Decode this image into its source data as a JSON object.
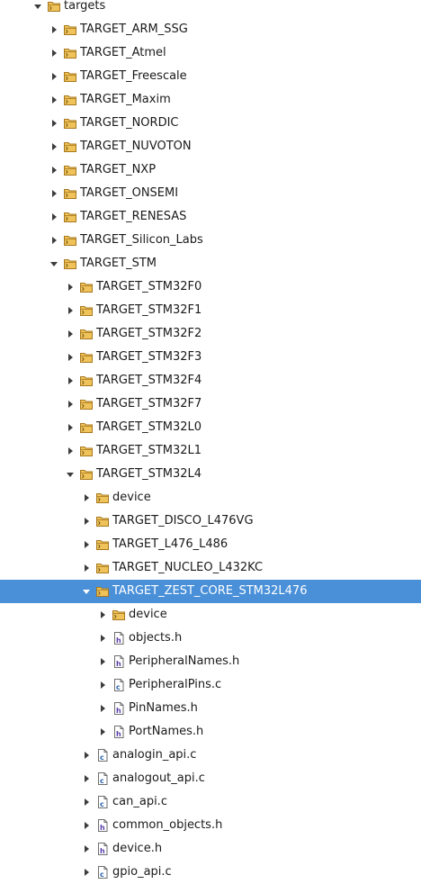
{
  "tree": {
    "items": [
      {
        "label": "targets",
        "type": "folder",
        "depth": 0,
        "expanded": true
      },
      {
        "label": "TARGET_ARM_SSG",
        "type": "folder",
        "depth": 1,
        "expanded": false
      },
      {
        "label": "TARGET_Atmel",
        "type": "folder",
        "depth": 1,
        "expanded": false
      },
      {
        "label": "TARGET_Freescale",
        "type": "folder",
        "depth": 1,
        "expanded": false
      },
      {
        "label": "TARGET_Maxim",
        "type": "folder",
        "depth": 1,
        "expanded": false
      },
      {
        "label": "TARGET_NORDIC",
        "type": "folder",
        "depth": 1,
        "expanded": false
      },
      {
        "label": "TARGET_NUVOTON",
        "type": "folder",
        "depth": 1,
        "expanded": false
      },
      {
        "label": "TARGET_NXP",
        "type": "folder",
        "depth": 1,
        "expanded": false
      },
      {
        "label": "TARGET_ONSEMI",
        "type": "folder",
        "depth": 1,
        "expanded": false
      },
      {
        "label": "TARGET_RENESAS",
        "type": "folder",
        "depth": 1,
        "expanded": false
      },
      {
        "label": "TARGET_Silicon_Labs",
        "type": "folder",
        "depth": 1,
        "expanded": false
      },
      {
        "label": "TARGET_STM",
        "type": "folder",
        "depth": 1,
        "expanded": true
      },
      {
        "label": "TARGET_STM32F0",
        "type": "folder",
        "depth": 2,
        "expanded": false
      },
      {
        "label": "TARGET_STM32F1",
        "type": "folder",
        "depth": 2,
        "expanded": false
      },
      {
        "label": "TARGET_STM32F2",
        "type": "folder",
        "depth": 2,
        "expanded": false
      },
      {
        "label": "TARGET_STM32F3",
        "type": "folder",
        "depth": 2,
        "expanded": false
      },
      {
        "label": "TARGET_STM32F4",
        "type": "folder",
        "depth": 2,
        "expanded": false
      },
      {
        "label": "TARGET_STM32F7",
        "type": "folder",
        "depth": 2,
        "expanded": false
      },
      {
        "label": "TARGET_STM32L0",
        "type": "folder",
        "depth": 2,
        "expanded": false
      },
      {
        "label": "TARGET_STM32L1",
        "type": "folder",
        "depth": 2,
        "expanded": false
      },
      {
        "label": "TARGET_STM32L4",
        "type": "folder",
        "depth": 2,
        "expanded": true
      },
      {
        "label": "device",
        "type": "folder",
        "depth": 3,
        "expanded": false
      },
      {
        "label": "TARGET_DISCO_L476VG",
        "type": "folder",
        "depth": 3,
        "expanded": false
      },
      {
        "label": "TARGET_L476_L486",
        "type": "folder",
        "depth": 3,
        "expanded": false
      },
      {
        "label": "TARGET_NUCLEO_L432KC",
        "type": "folder",
        "depth": 3,
        "expanded": false
      },
      {
        "label": "TARGET_ZEST_CORE_STM32L476",
        "type": "folder",
        "depth": 3,
        "expanded": true,
        "selected": true
      },
      {
        "label": "device",
        "type": "folder",
        "depth": 4,
        "expanded": false
      },
      {
        "label": "objects.h",
        "type": "file-h",
        "depth": 4,
        "expanded": false
      },
      {
        "label": "PeripheralNames.h",
        "type": "file-h",
        "depth": 4,
        "expanded": false
      },
      {
        "label": "PeripheralPins.c",
        "type": "file-c",
        "depth": 4,
        "expanded": false
      },
      {
        "label": "PinNames.h",
        "type": "file-h",
        "depth": 4,
        "expanded": false
      },
      {
        "label": "PortNames.h",
        "type": "file-h",
        "depth": 4,
        "expanded": false
      },
      {
        "label": "analogin_api.c",
        "type": "file-c",
        "depth": 3,
        "expanded": false
      },
      {
        "label": "analogout_api.c",
        "type": "file-c",
        "depth": 3,
        "expanded": false
      },
      {
        "label": "can_api.c",
        "type": "file-c",
        "depth": 3,
        "expanded": false
      },
      {
        "label": "common_objects.h",
        "type": "file-h",
        "depth": 3,
        "expanded": false
      },
      {
        "label": "device.h",
        "type": "file-h",
        "depth": 3,
        "expanded": false
      },
      {
        "label": "gpio_api.c",
        "type": "file-c",
        "depth": 3,
        "expanded": false
      }
    ]
  },
  "colors": {
    "selection": "#4a90d9",
    "folder_body": "#f0c35a",
    "folder_outline": "#a7781e",
    "arrow": "#3c3c3c"
  }
}
